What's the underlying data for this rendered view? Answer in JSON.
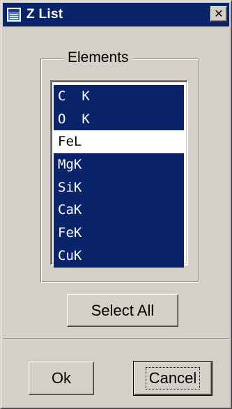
{
  "window": {
    "title": "Z List",
    "app_icon": "window-icon",
    "close_icon": "close-icon",
    "close_glyph": "✕"
  },
  "group": {
    "label": "Elements"
  },
  "list": {
    "items": [
      {
        "label": "C  K",
        "selected": true
      },
      {
        "label": "O  K",
        "selected": true
      },
      {
        "label": "FeL",
        "selected": false
      },
      {
        "label": "MgK",
        "selected": true
      },
      {
        "label": "SiK",
        "selected": true
      },
      {
        "label": "CaK",
        "selected": true
      },
      {
        "label": "FeK",
        "selected": true
      },
      {
        "label": "CuK",
        "selected": true
      }
    ]
  },
  "buttons": {
    "select_all": "Select All",
    "ok": "Ok",
    "cancel": "Cancel"
  },
  "colors": {
    "face": "#d4d0c8",
    "selection": "#0a246a",
    "titlebar": "#0a246a"
  }
}
